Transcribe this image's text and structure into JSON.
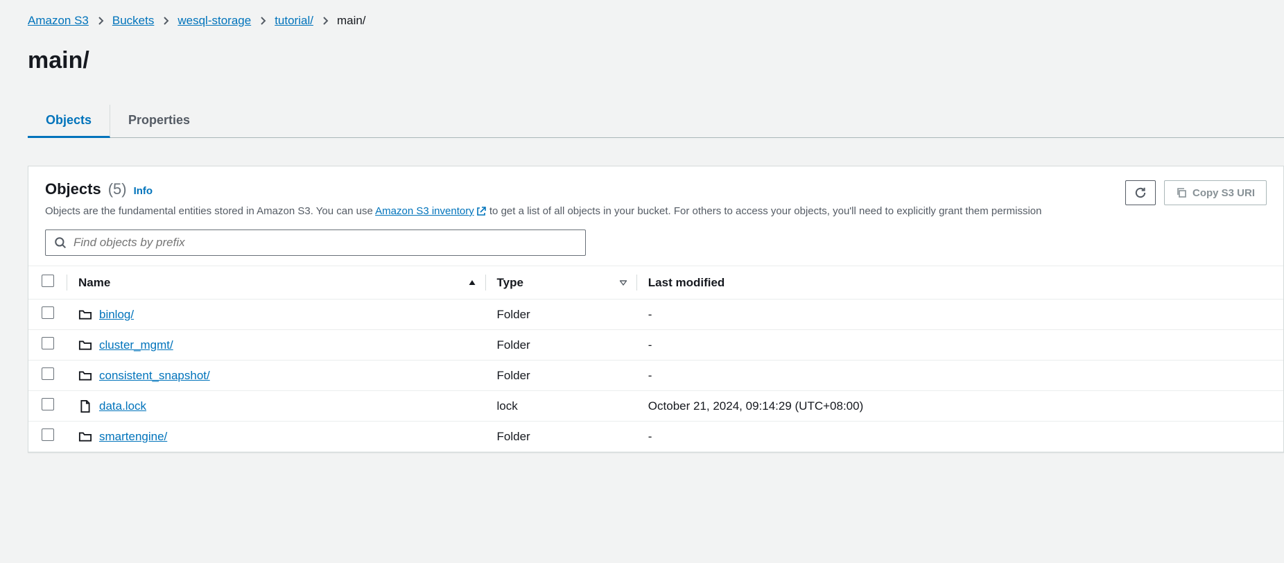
{
  "breadcrumb": {
    "items": [
      {
        "label": "Amazon S3",
        "link": true
      },
      {
        "label": "Buckets",
        "link": true
      },
      {
        "label": "wesql-storage",
        "link": true
      },
      {
        "label": "tutorial/",
        "link": true
      },
      {
        "label": "main/",
        "link": false
      }
    ]
  },
  "page_title": "main/",
  "tabs": {
    "objects": "Objects",
    "properties": "Properties"
  },
  "panel": {
    "title": "Objects",
    "count": "(5)",
    "info": "Info",
    "desc_prefix": "Objects are the fundamental entities stored in Amazon S3. You can use ",
    "desc_link": "Amazon S3 inventory",
    "desc_suffix": " to get a list of all objects in your bucket. For others to access your objects, you'll need to explicitly grant them permission",
    "copy_uri": "Copy S3 URI"
  },
  "search": {
    "placeholder": "Find objects by prefix"
  },
  "columns": {
    "name": "Name",
    "type": "Type",
    "last_modified": "Last modified"
  },
  "rows": [
    {
      "name": "binlog/",
      "icon": "folder",
      "type": "Folder",
      "last_modified": "-"
    },
    {
      "name": "cluster_mgmt/",
      "icon": "folder",
      "type": "Folder",
      "last_modified": "-"
    },
    {
      "name": "consistent_snapshot/",
      "icon": "folder",
      "type": "Folder",
      "last_modified": "-"
    },
    {
      "name": "data.lock",
      "icon": "file",
      "type": "lock",
      "last_modified": "October 21, 2024, 09:14:29 (UTC+08:00)"
    },
    {
      "name": "smartengine/",
      "icon": "folder",
      "type": "Folder",
      "last_modified": "-"
    }
  ]
}
